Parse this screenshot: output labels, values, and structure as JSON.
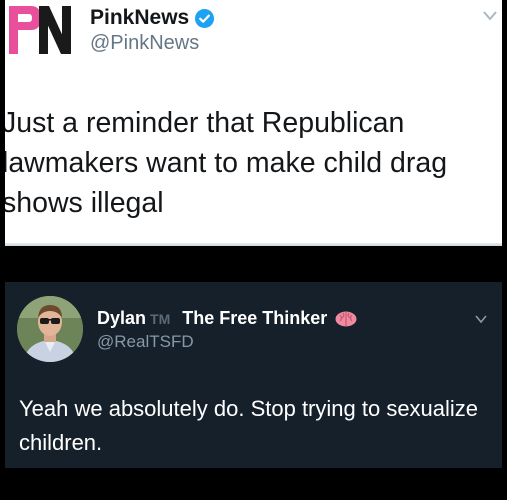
{
  "top_tweet": {
    "display_name": "PinkNews",
    "handle": "@PinkNews",
    "text": "Just a reminder that Republican lawmakers want to make child drag shows illegal",
    "logo_text": "PN",
    "colors": {
      "logo_pink": "#e8509b",
      "logo_dark": "#1a1a1a",
      "verified": "#1da1f2"
    }
  },
  "bottom_tweet": {
    "display_name": "Dylan",
    "tm_mark": "TM",
    "display_name_suffix": "The Free Thinker",
    "handle": "@RealTSFD",
    "text": "Yeah we absolutely do. Stop trying to sexualize children.",
    "colors": {
      "background": "#15202b",
      "brain": "#f08aa0"
    }
  }
}
